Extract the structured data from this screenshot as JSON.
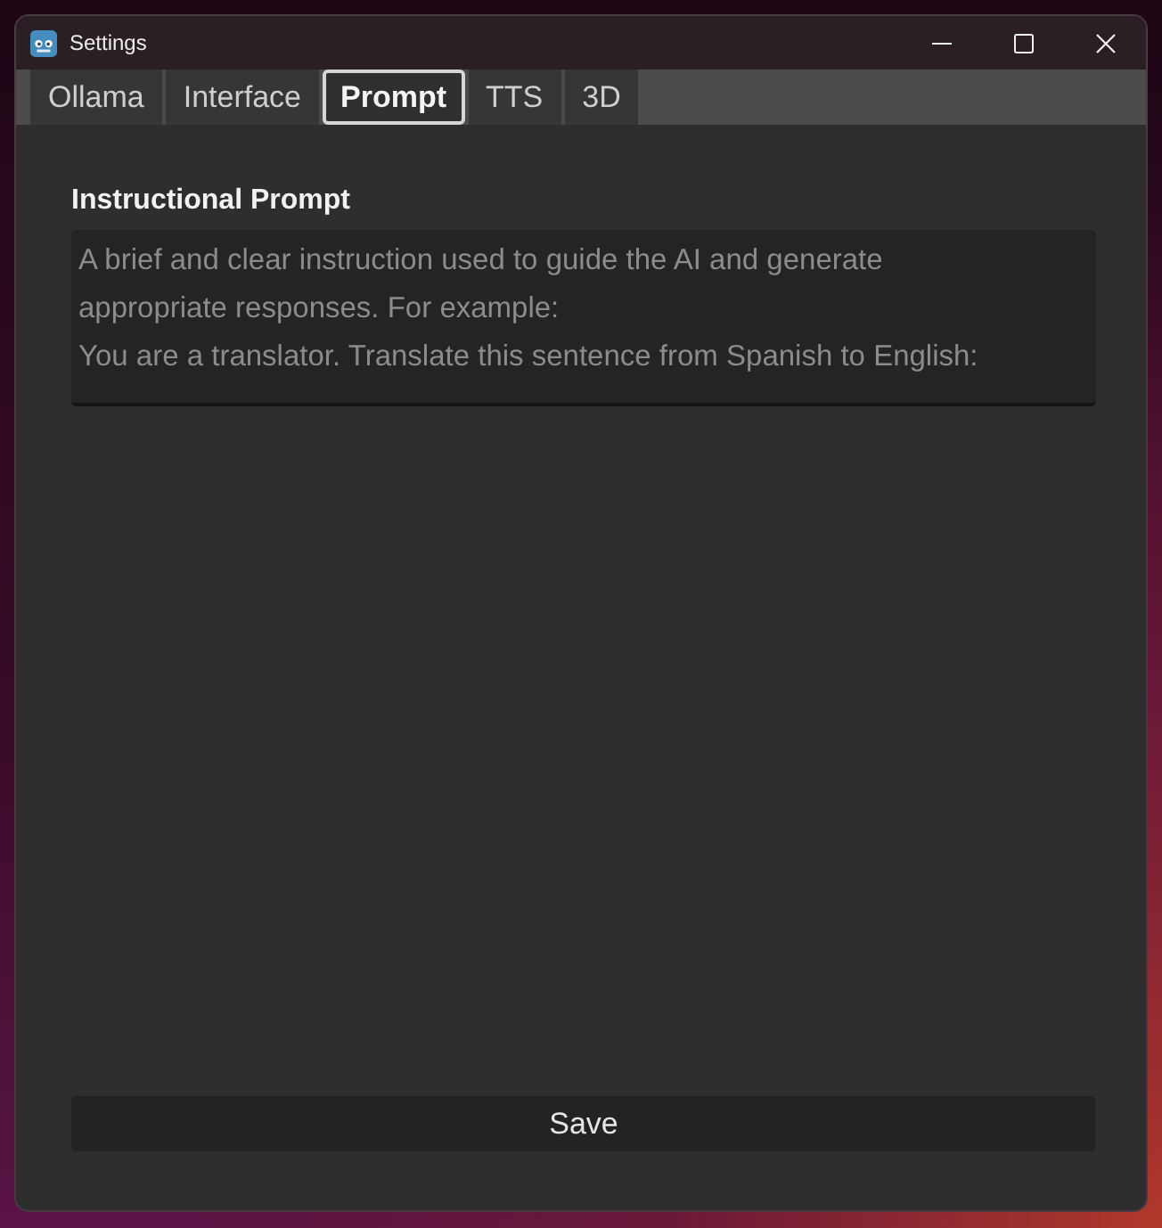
{
  "window": {
    "title": "Settings"
  },
  "tabs": [
    {
      "label": "Ollama",
      "selected": false
    },
    {
      "label": "Interface",
      "selected": false
    },
    {
      "label": "Prompt",
      "selected": true
    },
    {
      "label": "TTS",
      "selected": false
    },
    {
      "label": "3D",
      "selected": false
    }
  ],
  "prompt_field": {
    "label": "Instructional Prompt",
    "placeholder": "A brief and clear instruction used to guide the AI and generate appropriate responses. For example:\nYou are a translator. Translate this sentence from Spanish to English:"
  },
  "save_button": {
    "label": "Save"
  }
}
